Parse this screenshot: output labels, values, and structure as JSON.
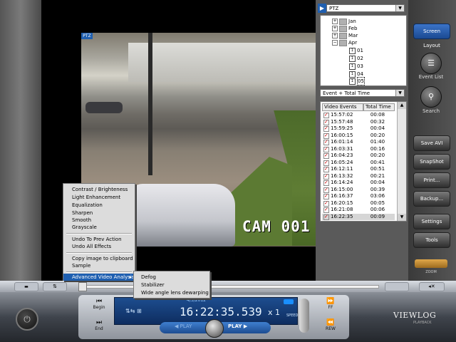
{
  "video": {
    "ptz_tag": "PTZ",
    "camera_label": "CAM 001"
  },
  "right_panel": {
    "mode_combo": "PTZ",
    "tree": {
      "months": [
        "Jan",
        "Feb",
        "Mar",
        "Apr"
      ],
      "days": [
        "01",
        "02",
        "03",
        "04",
        "05"
      ]
    },
    "filter_combo": "Event + Total Time",
    "events_table": {
      "headers": [
        "Video Events",
        "Total Time"
      ],
      "rows": [
        {
          "time": "15:57:02",
          "total": "00:08"
        },
        {
          "time": "15:57:48",
          "total": "00:32"
        },
        {
          "time": "15:59:25",
          "total": "00:04"
        },
        {
          "time": "16:00:15",
          "total": "00:20"
        },
        {
          "time": "16:01:14",
          "total": "01:40"
        },
        {
          "time": "16:03:31",
          "total": "00:16"
        },
        {
          "time": "16:04:23",
          "total": "00:20"
        },
        {
          "time": "16:05:24",
          "total": "00:41"
        },
        {
          "time": "16:12:11",
          "total": "00:51"
        },
        {
          "time": "16:13:32",
          "total": "00:21"
        },
        {
          "time": "16:14:24",
          "total": "00:04"
        },
        {
          "time": "16:15:00",
          "total": "00:39"
        },
        {
          "time": "16:16:37",
          "total": "03:06"
        },
        {
          "time": "16:20:15",
          "total": "00:05"
        },
        {
          "time": "16:21:08",
          "total": "00:06"
        },
        {
          "time": "16:22:35",
          "total": "00:09"
        }
      ]
    }
  },
  "sidebar": {
    "screen_layout": "Screen Layout",
    "event_list": "Event List",
    "search": "Search",
    "save_avi": "Save AVI",
    "snapshot": "SnapShot",
    "print": "Print...",
    "backup": "Backup...",
    "settings": "Settings",
    "tools": "Tools",
    "zoom": "ZOOM"
  },
  "context_menu": {
    "items": [
      "Contrast / Brighteness",
      "Light Enhancement",
      "Equalization",
      "Sharpen",
      "Smooth",
      "Grayscale",
      "Undo To Prev Action",
      "Undo All Effects",
      "Copy image to clipboard",
      "Sample",
      "Advanced Video Analysis"
    ],
    "submenu": [
      "Defog",
      "Stabilizer",
      "Wide angle lens dewarping"
    ]
  },
  "transport": {
    "date": "4/5/2012",
    "time": "16:22:35.539",
    "speed": "x 1",
    "speed_label": "SPEED",
    "begin": "Begin",
    "end": "End",
    "ff": "FF",
    "rew": "REW",
    "rev_play": "PLAY",
    "play": "PLAY",
    "brand": "VIEWLOG",
    "brand_sub": "PLAYBACK"
  },
  "colors": {
    "accent_blue": "#1f5fb0",
    "lcd_blue": "#1d4d8f",
    "checkmark_red": "#cc0000"
  }
}
